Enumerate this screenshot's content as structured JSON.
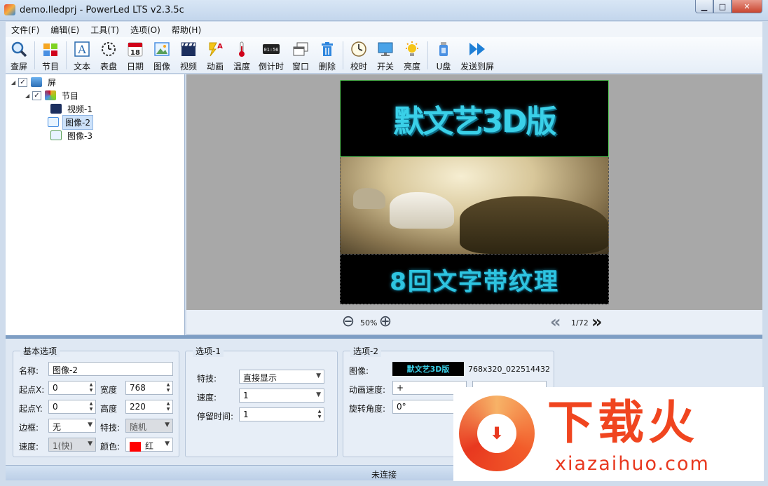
{
  "window": {
    "title": "demo.lledprj - PowerLed LTS v2.3.5c",
    "minimize": "▁",
    "maximize": "□",
    "close": "✕"
  },
  "menu": [
    "文件(F)",
    "编辑(E)",
    "工具(T)",
    "选项(O)",
    "帮助(H)"
  ],
  "toolbar": [
    {
      "label": "查屏",
      "icon": "magnifier-icon"
    },
    {
      "label": "节目",
      "icon": "program-icon"
    },
    {
      "label": "文本",
      "icon": "text-icon"
    },
    {
      "label": "表盘",
      "icon": "clock-dial-icon"
    },
    {
      "label": "日期",
      "icon": "calendar-icon",
      "icon_text": "18"
    },
    {
      "label": "图像",
      "icon": "image-icon"
    },
    {
      "label": "视频",
      "icon": "video-icon"
    },
    {
      "label": "动画",
      "icon": "animation-icon"
    },
    {
      "label": "温度",
      "icon": "thermometer-icon"
    },
    {
      "label": "倒计时",
      "icon": "countdown-icon",
      "icon_text": "01:56"
    },
    {
      "label": "窗口",
      "icon": "window-icon"
    },
    {
      "label": "删除",
      "icon": "trash-icon"
    },
    {
      "label": "校时",
      "icon": "time-sync-icon"
    },
    {
      "label": "开关",
      "icon": "monitor-icon"
    },
    {
      "label": "亮度",
      "icon": "brightness-icon"
    },
    {
      "label": "U盘",
      "icon": "usb-drive-icon"
    },
    {
      "label": "发送到屏",
      "icon": "send-to-screen-icon"
    }
  ],
  "tree": {
    "screen": "屏",
    "program": "节目",
    "items": [
      "视频-1",
      "图像-2",
      "图像-3"
    ],
    "selected": "图像-2"
  },
  "preview": {
    "top_banner_text": "默文艺3D版",
    "bottom_banner_text": "8回文字带纹理",
    "zoom": "50%",
    "page": "1/72"
  },
  "basic": {
    "title": "基本选项",
    "name_label": "名称:",
    "name_value": "图像-2",
    "x_label": "起点X:",
    "x_value": "0",
    "width_label": "宽度",
    "width_value": "768",
    "y_label": "起点Y:",
    "y_value": "0",
    "height_label": "高度",
    "height_value": "220",
    "border_label": "边框:",
    "border_value": "无",
    "effect_label": "特技:",
    "effect_value": "随机",
    "speed_label": "速度:",
    "speed_value": "1(快)",
    "color_label": "颜色:",
    "color_value": "红",
    "color_hex": "#ff0000"
  },
  "option1": {
    "title": "选项-1",
    "effect_label": "特技:",
    "effect_value": "直接显示",
    "speed_label": "速度:",
    "speed_value": "1",
    "stay_label": "停留时间:",
    "stay_value": "1"
  },
  "option2": {
    "title": "选项-2",
    "image_label": "图像:",
    "image_info": "768x320_022514432",
    "anim_speed_label": "动画速度:",
    "anim_speed_value": "+",
    "rotate_label": "旋转角度:",
    "rotate_value": "0°"
  },
  "status": "未连接",
  "watermark": {
    "brand": "下载火",
    "url": "xiazaihuo.com"
  }
}
